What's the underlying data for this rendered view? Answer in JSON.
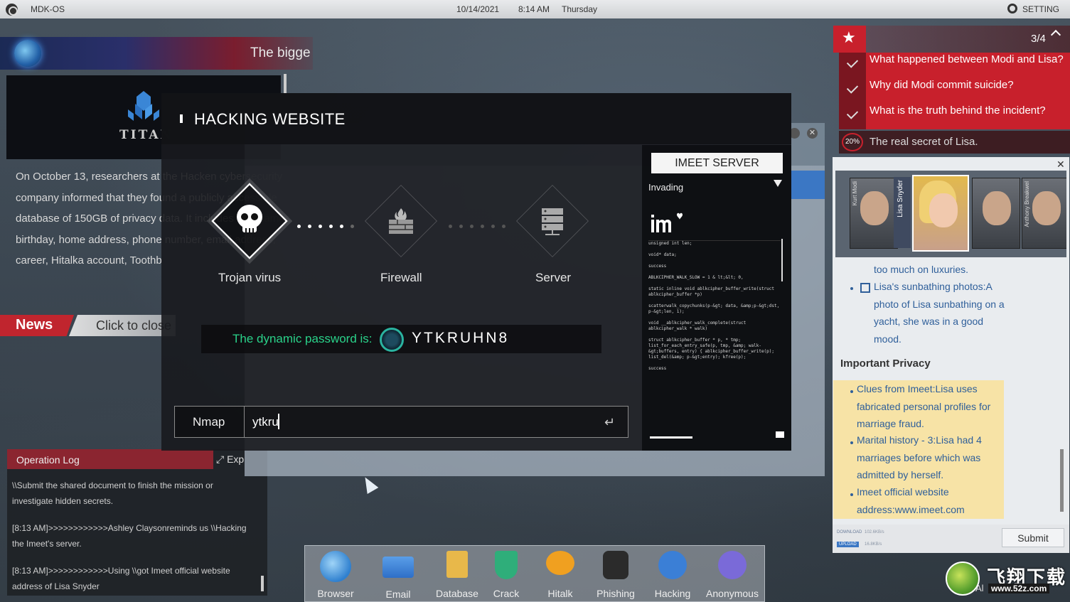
{
  "topbar": {
    "os_name": "MDK-OS",
    "date": "10/14/2021",
    "time": "8:14 AM",
    "day": "Thursday",
    "setting_label": "SETTING"
  },
  "news": {
    "headline": "The bigge",
    "logo_text": "TITAN",
    "body": "On October 13, researchers at the Hacken cybersecurity company informed that they found a publicly accessible database of 150GB of privacy data. It includes true names, birthday, home address, phone number, email address, career, Hitalka account, Toothb",
    "label": "News",
    "click_text": "Click to close"
  },
  "operation_log": {
    "title": "Operation Log",
    "expand_label": "Exp",
    "entries": [
      "\\\\Submit the shared document to finish the mission or investigate hidden secrets.",
      "[8:13 AM]>>>>>>>>>>>>Ashley Claysonreminds us \\\\Hacking the Imeet's server.",
      "[8:13 AM]>>>>>>>>>>>>Using \\\\got Imeet official website address of Lisa Snyder"
    ]
  },
  "hacking": {
    "title": "HACKING WEBSITE",
    "nodes": [
      {
        "label": "Trojan virus",
        "icon": "skull-icon",
        "active": true
      },
      {
        "label": "Firewall",
        "icon": "firewall-icon",
        "active": false
      },
      {
        "label": "Server",
        "icon": "server-icon",
        "active": false
      }
    ],
    "password_label": "The dynamic password is:",
    "password_value": "YTKRUHN8",
    "tool_label": "Nmap",
    "input_value": "ytkru"
  },
  "server_panel": {
    "button_label": "IMEET SERVER",
    "status": "Invading",
    "code_lines": [
      "unsigned int len;",
      "void* data;",
      "success",
      "ABLKCIPHER_WALK_SLOW = 1 & lt;&lt; 0,",
      "static inline void ablkcipher_buffer_write(struct ablkcipher_buffer *p)",
      "scatterwalk_copychunks(p-&gt; data, &amp;p-&gt;dst, p-&gt;len, 1);",
      "void __ablkcipher_walk_complete(struct ablkcipher_walk * walk)",
      "struct ablkcipher_buffer * p, * tmp; list_for_each_entry_safe(p, tmp, &amp; walk-&gt;buffers, entry) { ablkcipher_buffer_write(p); list_del(&amp; p-&gt;entry); kfree(p);",
      "success"
    ]
  },
  "tasks": {
    "count": "3/4",
    "items": [
      {
        "text": "What happened between Modi and Lisa?",
        "done": true
      },
      {
        "text": "Why did Modi commit suicide?",
        "done": true
      },
      {
        "text": "What is the truth behind the incident?",
        "done": true
      }
    ],
    "last": {
      "progress": "20%",
      "text": "The real secret of Lisa."
    }
  },
  "evidence": {
    "people": [
      "Kurt Modi",
      "Lisa Snyder",
      "",
      "Anthony Breakwel"
    ],
    "items": [
      "too much on luxuries.",
      "Lisa's sunbathing photos:A photo of Lisa sunbathing on a yacht, she was in a good mood."
    ],
    "section_title": "Important Privacy",
    "privacy_items": [
      "Clues from Imeet:Lisa uses fabricated personal profiles for marriage fraud.",
      "Marital history - 3:Lisa had 4 marriages before which was admitted by herself.",
      "Imeet official website address:www.imeet.com"
    ],
    "download_label": "DOWNLOAD",
    "download_value": "102.6KB/s",
    "upload_label": "UPLOAD",
    "upload_value": "16.8KB/s",
    "submit_label": "Submit"
  },
  "dock": {
    "apps": [
      {
        "label": "Browser",
        "icon": "globe-icon",
        "color": "#3d8fd8"
      },
      {
        "label": "Email",
        "icon": "envelope-icon",
        "color": "#3b7fd6"
      },
      {
        "label": "Database",
        "icon": "database-icon",
        "color": "#e8b84a"
      },
      {
        "label": "Crack",
        "icon": "shield-icon",
        "color": "#2fae7a"
      },
      {
        "label": "Hitalk",
        "icon": "chat-icon",
        "color": "#f0a020"
      },
      {
        "label": "Phishing",
        "icon": "hacker-icon",
        "color": "#333333"
      },
      {
        "label": "Hacking",
        "icon": "hook-icon",
        "color": "#3b7fd6"
      },
      {
        "label": "Anonymous",
        "icon": "phone-icon",
        "color": "#7a6ad8"
      }
    ]
  },
  "watermark": {
    "brand": "飞翔下载",
    "url": "www.52z.com",
    "prefix": "Al"
  }
}
